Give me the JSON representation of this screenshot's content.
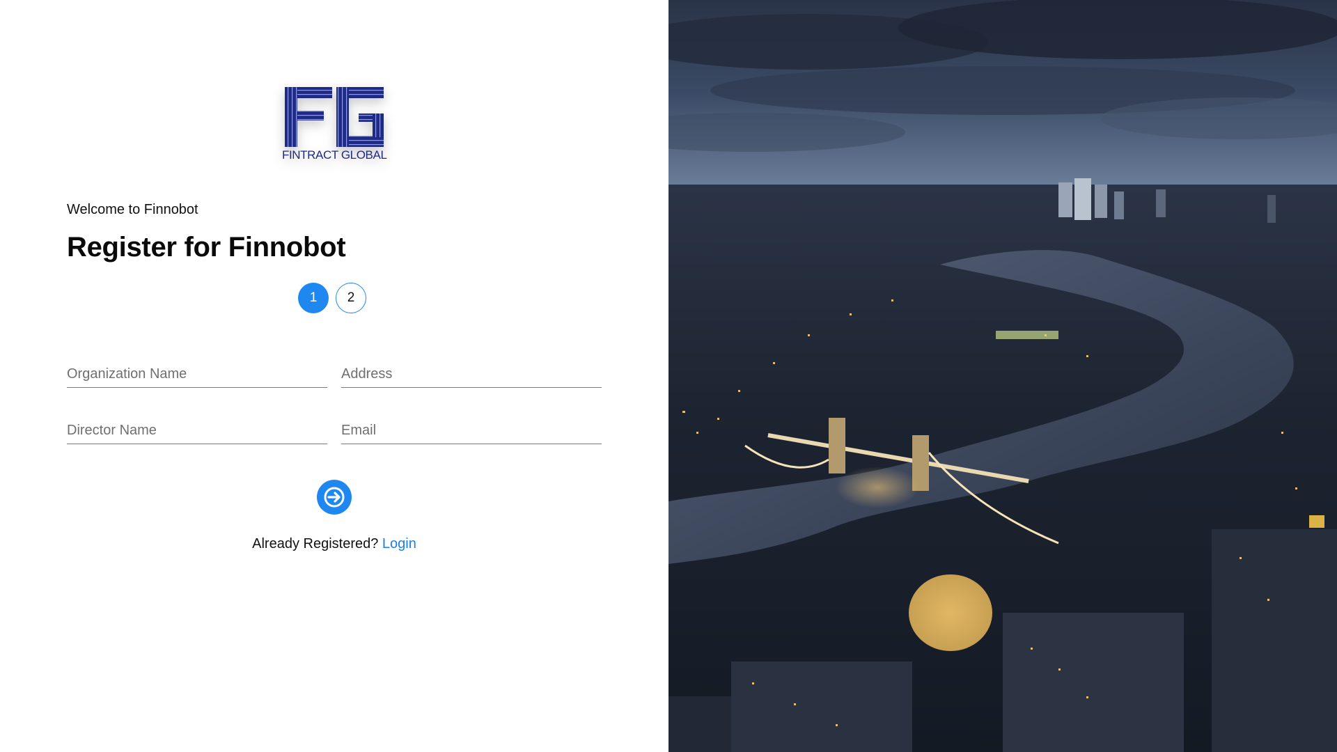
{
  "logo": {
    "monogram": "FG",
    "text": "FINTRACT GLOBAL",
    "color": "#1e2a86"
  },
  "header": {
    "welcome": "Welcome to Finnobot",
    "title": "Register for Finnobot"
  },
  "stepper": {
    "steps": [
      "1",
      "2"
    ],
    "active_step": "1"
  },
  "form": {
    "organization_name": {
      "placeholder": "Organization Name",
      "value": ""
    },
    "address": {
      "placeholder": "Address",
      "value": ""
    },
    "director_name": {
      "placeholder": "Director Name",
      "value": ""
    },
    "email": {
      "placeholder": "Email",
      "value": ""
    },
    "next_icon": "arrow-right-circle-icon"
  },
  "footer": {
    "prompt": "Already Registered?",
    "login_label": "Login"
  },
  "colors": {
    "accent": "#1e88f0",
    "link": "#1e7fe0",
    "logo": "#1e2a86"
  }
}
